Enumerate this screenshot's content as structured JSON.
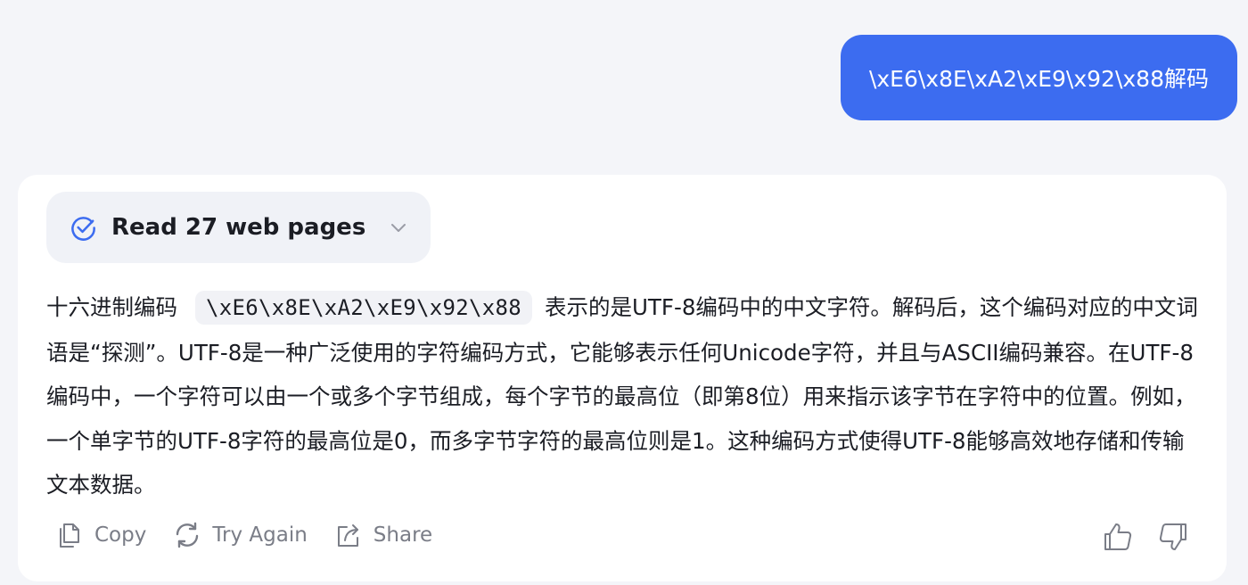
{
  "user_message": "\\xE6\\x8E\\xA2\\xE9\\x92\\x88解码",
  "sources": {
    "label": "Read 27 web pages",
    "icon": "check-circle-icon",
    "accent": "#3c6cf0"
  },
  "answer": {
    "prefix": "十六进制编码",
    "code": "\\xE6\\x8E\\xA2\\xE9\\x92\\x88",
    "body": "表示的是UTF-8编码中的中文字符。解码后，这个编码对应的中文词语是“探测”。UTF-8是一种广泛使用的字符编码方式，它能够表示任何Unicode字符，并且与ASCII编码兼容。在UTF-8编码中，一个字符可以由一个或多个字节组成，每个字节的最高位（即第8位）用来指示该字节在字符中的位置。例如，一个单字节的UTF-8字符的最高位是0，而多字节字符的最高位则是1。这种编码方式使得UTF-8能够高效地存储和传输文本数据。"
  },
  "actions": {
    "copy": "Copy",
    "try_again": "Try Again",
    "share": "Share"
  },
  "colors": {
    "user_bubble": "#3c6cf0",
    "background": "#f4f5f9",
    "card": "#ffffff",
    "muted": "#7a7d87"
  }
}
